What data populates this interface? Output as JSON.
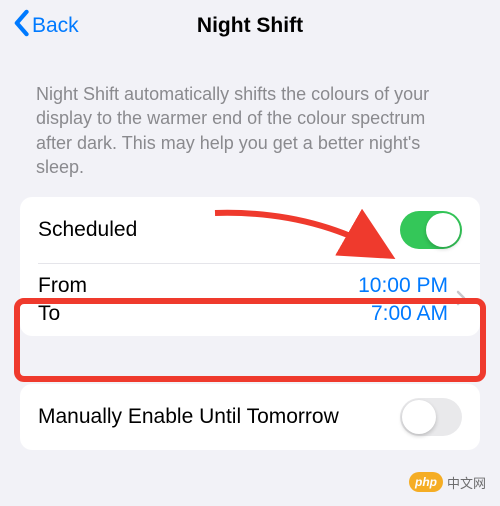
{
  "nav": {
    "back": "Back",
    "title": "Night Shift"
  },
  "description": "Night Shift automatically shifts the colours of your display to the warmer end of the colour spectrum after dark. This may help you get a better night's sleep.",
  "scheduled": {
    "label": "Scheduled",
    "enabled": true
  },
  "schedule": {
    "from_label": "From",
    "to_label": "To",
    "from_time": "10:00 PM",
    "to_time": "7:00 AM"
  },
  "manual": {
    "label": "Manually Enable Until Tomorrow",
    "enabled": false
  },
  "watermark": {
    "badge": "php",
    "text": "中文网"
  },
  "colors": {
    "accent": "#007aff",
    "toggle_on": "#34c759",
    "annotation": "#ef3a2d"
  }
}
